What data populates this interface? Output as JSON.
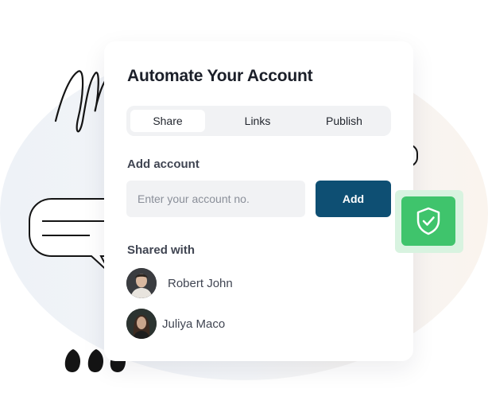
{
  "card": {
    "title": "Automate Your Account",
    "tabs": [
      {
        "label": "Share",
        "active": true
      },
      {
        "label": "Links",
        "active": false
      },
      {
        "label": "Publish",
        "active": false
      }
    ],
    "add_account": {
      "label": "Add account",
      "input_placeholder": "Enter your account no.",
      "input_value": "",
      "button_label": "Add"
    },
    "shared_with": {
      "label": "Shared with",
      "users": [
        {
          "name": "Robert John"
        },
        {
          "name": "Juliya Maco"
        }
      ]
    }
  },
  "decorations": {
    "shield_icon": "shield-check-icon",
    "accent_colors": {
      "add_button": "#0e4f73",
      "shield": "#3fc46c",
      "shield_bg": "#d8f3e0"
    }
  }
}
